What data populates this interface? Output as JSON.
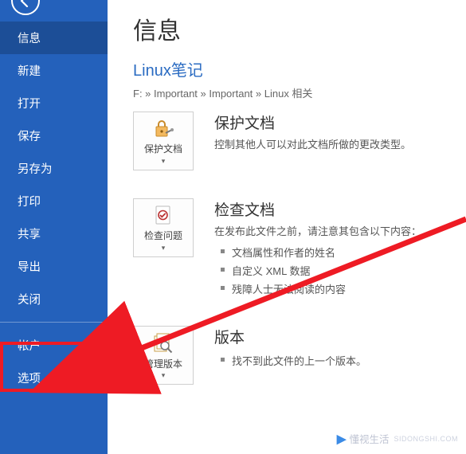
{
  "sidebar": {
    "items": [
      {
        "label": "信息"
      },
      {
        "label": "新建"
      },
      {
        "label": "打开"
      },
      {
        "label": "保存"
      },
      {
        "label": "另存为"
      },
      {
        "label": "打印"
      },
      {
        "label": "共享"
      },
      {
        "label": "导出"
      },
      {
        "label": "关闭"
      },
      {
        "label": "帐户"
      },
      {
        "label": "选项"
      }
    ]
  },
  "main": {
    "page_title": "信息",
    "doc_title": "Linux笔记",
    "breadcrumb": "F: » Important » Important » Linux 相关"
  },
  "protect": {
    "tile_label": "保护文档",
    "title": "保护文档",
    "desc": "控制其他人可以对此文档所做的更改类型。"
  },
  "inspect": {
    "tile_label": "检查问题",
    "title": "检查文档",
    "desc": "在发布此文件之前，请注意其包含以下内容：",
    "items": [
      "文档属性和作者的姓名",
      "自定义 XML 数据",
      "残障人士无法阅读的内容"
    ]
  },
  "versions": {
    "tile_label": "管理版本",
    "title": "版本",
    "items": [
      "找不到此文件的上一个版本。"
    ]
  },
  "watermark": {
    "text": "懂视生活",
    "sub": "SIDONGSHI.COM"
  }
}
